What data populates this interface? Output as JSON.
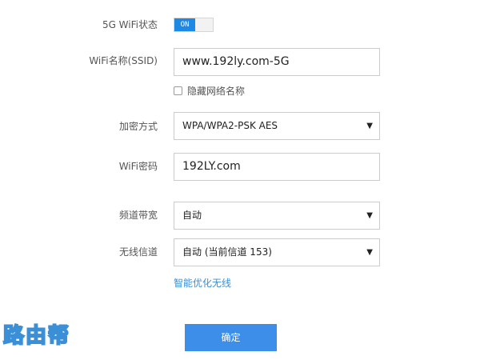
{
  "wifi_status": {
    "label": "5G WiFi状态",
    "toggle_text": "ON",
    "enabled": true
  },
  "ssid": {
    "label": "WiFi名称(SSID)",
    "value": "www.192ly.com-5G"
  },
  "hide_network": {
    "label": "隐藏网络名称",
    "checked": false
  },
  "encryption": {
    "label": "加密方式",
    "value": "WPA/WPA2-PSK AES"
  },
  "password": {
    "label": "WiFi密码",
    "value": "192LY.com"
  },
  "bandwidth": {
    "label": "频道带宽",
    "value": "自动"
  },
  "channel": {
    "label": "无线信道",
    "value": "自动 (当前信道 153)"
  },
  "optimize_link": "智能优化无线",
  "confirm_button": "确定",
  "watermark": "路由帮",
  "colors": {
    "accent": "#1e88e5",
    "button": "#3d8ee8",
    "link": "#3a8fd6"
  },
  "icons": {
    "dropdown": "caret-down-icon"
  }
}
